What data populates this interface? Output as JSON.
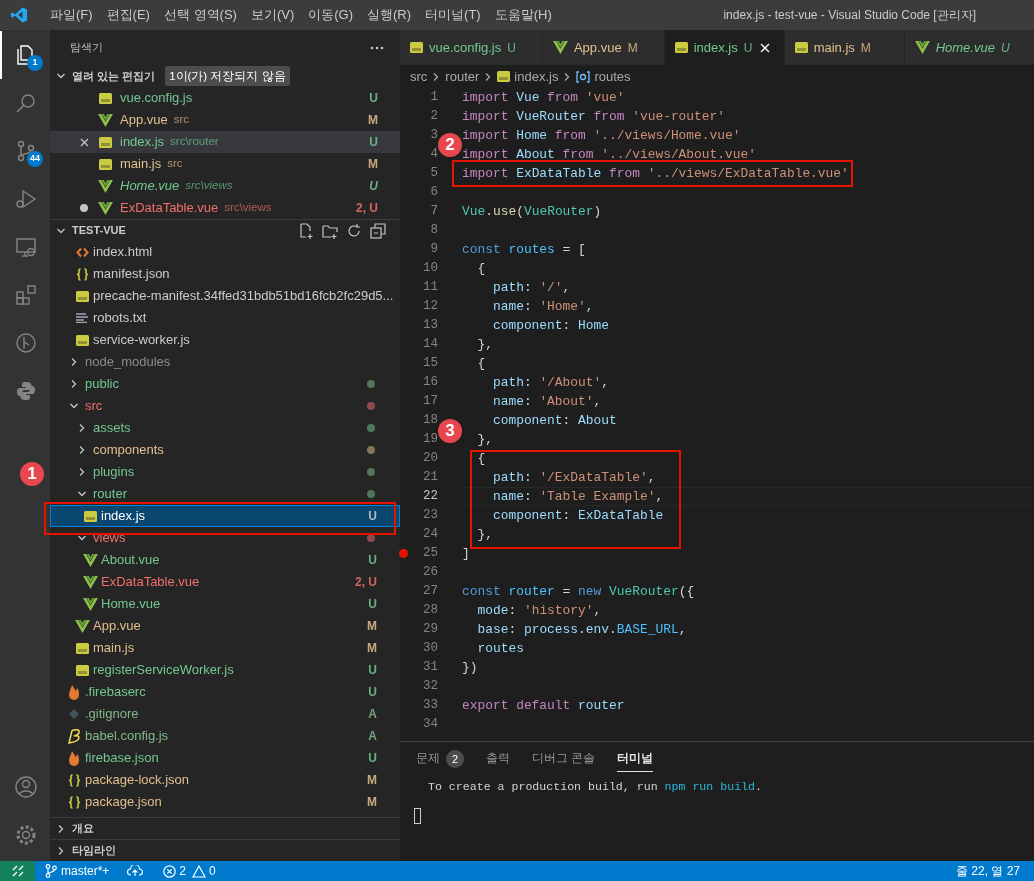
{
  "title_bar": {
    "menu": [
      "파일(F)",
      "편집(E)",
      "선택 영역(S)",
      "보기(V)",
      "이동(G)",
      "실행(R)",
      "터미널(T)",
      "도움말(H)"
    ],
    "title": "index.js - test-vue - Visual Studio Code [관리자]"
  },
  "activity_bar": [
    {
      "kind": "explorer",
      "selected": true,
      "badge": "1"
    },
    {
      "kind": "search",
      "selected": false
    },
    {
      "kind": "scm",
      "selected": false,
      "badge": "44"
    },
    {
      "kind": "debug",
      "selected": false
    },
    {
      "kind": "remote",
      "selected": false
    },
    {
      "kind": "extensions",
      "selected": false
    },
    {
      "kind": "git-graph",
      "selected": false
    },
    {
      "kind": "python",
      "selected": false
    }
  ],
  "activity_bottom": [
    {
      "kind": "account"
    },
    {
      "kind": "settings"
    }
  ],
  "sidebar": {
    "title": "탐색기",
    "open_editors": {
      "title": "열려 있는 편집기",
      "expanded": true,
      "badge": "1이(가) 저장되지 않음",
      "items": [
        {
          "kind": "js",
          "name": "vue.config.js",
          "status": "U",
          "color": "#73c991",
          "selected": false,
          "dirty": false,
          "italic": false
        },
        {
          "kind": "vue",
          "name": "App.vue",
          "path": "src",
          "status": "M",
          "color": "#e2c08d",
          "selected": false,
          "dirty": false,
          "italic": false
        },
        {
          "kind": "js",
          "name": "index.js",
          "path": "src\\router",
          "status": "U",
          "color": "#73c991",
          "selected": true,
          "dirty": false,
          "italic": false
        },
        {
          "kind": "js",
          "name": "main.js",
          "path": "src",
          "status": "M",
          "color": "#e2c08d",
          "selected": false,
          "dirty": false,
          "italic": false
        },
        {
          "kind": "vue",
          "name": "Home.vue",
          "path": "src\\views",
          "status": "U",
          "color": "#73c991",
          "selected": false,
          "dirty": false,
          "italic": true
        },
        {
          "kind": "vue",
          "name": "ExDataTable.vue",
          "path": "src\\views",
          "status": "2, U",
          "color": "#f0706a",
          "selected": false,
          "dirty": true,
          "italic": false
        }
      ]
    },
    "explorer": {
      "title": "TEST-VUE",
      "expanded": true,
      "continued_items": [
        {
          "kind": "html",
          "name": "index.html",
          "color": "#cccccc",
          "selected": false
        },
        {
          "kind": "json",
          "name": "manifest.json",
          "color": "#cccccc",
          "selected": false
        },
        {
          "kind": "js",
          "name": "precache-manifest.34ffed31bdb51bd16fcb2fc29d5...",
          "color": "#cccccc",
          "selected": false
        },
        {
          "kind": "txt",
          "name": "robots.txt",
          "color": "#cccccc",
          "selected": false
        },
        {
          "kind": "js",
          "name": "service-worker.js",
          "color": "#cccccc",
          "selected": false
        }
      ],
      "tree": [
        {
          "kind": "folder",
          "name": "node_modules",
          "expanded": false,
          "decorated": false,
          "color": "#8c8c8c",
          "selected": false
        },
        {
          "kind": "folder",
          "name": "public",
          "expanded": false,
          "decorated": true,
          "color": "#73c991",
          "selected": false
        },
        {
          "kind": "folder",
          "name": "src",
          "expanded": true,
          "decorated": true,
          "color": "#f0706a",
          "selected": false,
          "children": [
            {
              "kind": "folder",
              "name": "assets",
              "expanded": false,
              "decorated": true,
              "color": "#73c991",
              "selected": false
            },
            {
              "kind": "folder",
              "name": "components",
              "expanded": false,
              "decorated": true,
              "color": "#e2c08d",
              "selected": false
            },
            {
              "kind": "folder",
              "name": "plugins",
              "expanded": false,
              "decorated": true,
              "color": "#73c991",
              "selected": false
            },
            {
              "kind": "folder",
              "name": "router",
              "expanded": true,
              "decorated": true,
              "color": "#73c991",
              "selected": false,
              "children": [
                {
                  "kind": "js",
                  "name": "index.js",
                  "status": "U",
                  "color": "#ffffff",
                  "selected": true
                }
              ]
            },
            {
              "kind": "folder",
              "name": "views",
              "expanded": true,
              "decorated": true,
              "color": "#f0706a",
              "selected": false,
              "children": [
                {
                  "kind": "vue",
                  "name": "About.vue",
                  "status": "U",
                  "color": "#73c991",
                  "selected": false
                },
                {
                  "kind": "vue",
                  "name": "ExDataTable.vue",
                  "status": "2, U",
                  "color": "#f0706a",
                  "selected": false
                },
                {
                  "kind": "vue",
                  "name": "Home.vue",
                  "status": "U",
                  "color": "#73c991",
                  "selected": false
                }
              ]
            },
            {
              "kind": "vue",
              "name": "App.vue",
              "status": "M",
              "color": "#e2c08d",
              "selected": false
            },
            {
              "kind": "js",
              "name": "main.js",
              "status": "M",
              "color": "#e2c08d",
              "selected": false
            },
            {
              "kind": "js",
              "name": "registerServiceWorker.js",
              "status": "U",
              "color": "#73c991",
              "selected": false
            }
          ]
        },
        {
          "kind": "firebase",
          "name": ".firebaserc",
          "status": "U",
          "color": "#73c991",
          "selected": false
        },
        {
          "kind": "git",
          "name": ".gitignore",
          "status": "A",
          "color": "#81b88b",
          "selected": false
        },
        {
          "kind": "babel",
          "name": "babel.config.js",
          "status": "A",
          "color": "#81b88b",
          "selected": false
        },
        {
          "kind": "firebase",
          "name": "firebase.json",
          "status": "U",
          "color": "#73c991",
          "selected": false
        },
        {
          "kind": "json",
          "name": "package-lock.json",
          "status": "M",
          "color": "#e2c08d",
          "selected": false
        },
        {
          "kind": "json",
          "name": "package.json",
          "status": "M",
          "color": "#e2c08d",
          "selected": false
        }
      ]
    },
    "sections": [
      {
        "title": "개요",
        "expanded": false
      },
      {
        "title": "타임라인",
        "expanded": false
      }
    ]
  },
  "editor": {
    "tabs": [
      {
        "kind": "js",
        "name": "vue.config.js",
        "status": "U",
        "color": "#73c991",
        "selected": false,
        "italic": false
      },
      {
        "kind": "vue",
        "name": "App.vue",
        "status": "M",
        "color": "#e2c08d",
        "selected": false,
        "italic": false
      },
      {
        "kind": "js",
        "name": "index.js",
        "status": "U",
        "color": "#73c991",
        "selected": true,
        "italic": false
      },
      {
        "kind": "js",
        "name": "main.js",
        "status": "M",
        "color": "#e2c08d",
        "selected": false,
        "italic": false
      },
      {
        "kind": "vue",
        "name": "Home.vue",
        "status": "U",
        "color": "#73c991",
        "selected": false,
        "italic": true
      }
    ],
    "breadcrumb": [
      {
        "label": "src"
      },
      {
        "label": "router"
      },
      {
        "kind": "js",
        "label": "index.js"
      },
      {
        "kind": "variable",
        "label": "routes"
      }
    ],
    "lines": [
      {
        "n": "1",
        "current": false,
        "breakpoint": false,
        "tokens": [
          {
            "kind": "kw",
            "text": "import "
          },
          {
            "kind": "var",
            "text": "Vue "
          },
          {
            "kind": "kw",
            "text": "from "
          },
          {
            "kind": "str",
            "text": "'vue'"
          }
        ]
      },
      {
        "n": "2",
        "current": false,
        "breakpoint": false,
        "tokens": [
          {
            "kind": "kw",
            "text": "import "
          },
          {
            "kind": "var",
            "text": "VueRouter "
          },
          {
            "kind": "kw",
            "text": "from "
          },
          {
            "kind": "str",
            "text": "'vue-router'"
          }
        ]
      },
      {
        "n": "3",
        "current": false,
        "breakpoint": false,
        "tokens": [
          {
            "kind": "kw",
            "text": "import "
          },
          {
            "kind": "var",
            "text": "Home "
          },
          {
            "kind": "kw",
            "text": "from "
          },
          {
            "kind": "str",
            "text": "'../views/Home.vue'"
          }
        ]
      },
      {
        "n": "4",
        "current": false,
        "breakpoint": false,
        "tokens": [
          {
            "kind": "kw",
            "text": "import "
          },
          {
            "kind": "var",
            "text": "About "
          },
          {
            "kind": "kw",
            "text": "from "
          },
          {
            "kind": "str",
            "text": "'../views/About.vue'"
          }
        ]
      },
      {
        "n": "5",
        "current": false,
        "breakpoint": false,
        "tokens": [
          {
            "kind": "kw",
            "text": "import "
          },
          {
            "kind": "var",
            "text": "ExDataTable "
          },
          {
            "kind": "kw",
            "text": "from "
          },
          {
            "kind": "str",
            "text": "'../views/ExDataTable.vue'"
          }
        ]
      },
      {
        "n": "6",
        "current": false,
        "breakpoint": false
      },
      {
        "n": "7",
        "current": false,
        "breakpoint": false,
        "tokens": [
          {
            "kind": "cls",
            "text": "Vue"
          },
          {
            "kind": "plain",
            "text": "."
          },
          {
            "kind": "fn",
            "text": "use"
          },
          {
            "kind": "plain",
            "text": "("
          },
          {
            "kind": "cls",
            "text": "VueRouter"
          },
          {
            "kind": "plain",
            "text": ")"
          }
        ]
      },
      {
        "n": "8",
        "current": false,
        "breakpoint": false
      },
      {
        "n": "9",
        "current": false,
        "breakpoint": false,
        "tokens": [
          {
            "kind": "storage",
            "text": "const "
          },
          {
            "kind": "const",
            "text": "routes"
          },
          {
            "kind": "plain",
            "text": " = ["
          }
        ]
      },
      {
        "n": "10",
        "current": false,
        "breakpoint": false,
        "tokens": [
          {
            "kind": "plain",
            "text": "  {"
          }
        ]
      },
      {
        "n": "11",
        "current": false,
        "breakpoint": false,
        "tokens": [
          {
            "kind": "var",
            "text": "    path"
          },
          {
            "kind": "plain",
            "text": ": "
          },
          {
            "kind": "str",
            "text": "'/'"
          },
          {
            "kind": "plain",
            "text": ","
          }
        ]
      },
      {
        "n": "12",
        "current": false,
        "breakpoint": false,
        "tokens": [
          {
            "kind": "var",
            "text": "    name"
          },
          {
            "kind": "plain",
            "text": ": "
          },
          {
            "kind": "str",
            "text": "'Home'"
          },
          {
            "kind": "plain",
            "text": ","
          }
        ]
      },
      {
        "n": "13",
        "current": false,
        "breakpoint": false,
        "tokens": [
          {
            "kind": "var",
            "text": "    component"
          },
          {
            "kind": "plain",
            "text": ": "
          },
          {
            "kind": "var",
            "text": "Home"
          }
        ]
      },
      {
        "n": "14",
        "current": false,
        "breakpoint": false,
        "tokens": [
          {
            "kind": "plain",
            "text": "  },"
          }
        ]
      },
      {
        "n": "15",
        "current": false,
        "breakpoint": false,
        "tokens": [
          {
            "kind": "plain",
            "text": "  {"
          }
        ]
      },
      {
        "n": "16",
        "current": false,
        "breakpoint": false,
        "tokens": [
          {
            "kind": "var",
            "text": "    path"
          },
          {
            "kind": "plain",
            "text": ": "
          },
          {
            "kind": "str",
            "text": "'/About'"
          },
          {
            "kind": "plain",
            "text": ","
          }
        ]
      },
      {
        "n": "17",
        "current": false,
        "breakpoint": false,
        "tokens": [
          {
            "kind": "var",
            "text": "    name"
          },
          {
            "kind": "plain",
            "text": ": "
          },
          {
            "kind": "str",
            "text": "'About'"
          },
          {
            "kind": "plain",
            "text": ","
          }
        ]
      },
      {
        "n": "18",
        "current": false,
        "breakpoint": false,
        "tokens": [
          {
            "kind": "var",
            "text": "    component"
          },
          {
            "kind": "plain",
            "text": ": "
          },
          {
            "kind": "var",
            "text": "About"
          }
        ]
      },
      {
        "n": "19",
        "current": false,
        "breakpoint": false,
        "tokens": [
          {
            "kind": "plain",
            "text": "  },"
          }
        ]
      },
      {
        "n": "20",
        "current": false,
        "breakpoint": false,
        "tokens": [
          {
            "kind": "plain",
            "text": "  {"
          }
        ]
      },
      {
        "n": "21",
        "current": false,
        "breakpoint": false,
        "tokens": [
          {
            "kind": "var",
            "text": "    path"
          },
          {
            "kind": "plain",
            "text": ": "
          },
          {
            "kind": "str",
            "text": "'/ExDataTable'"
          },
          {
            "kind": "plain",
            "text": ","
          }
        ]
      },
      {
        "n": "22",
        "current": true,
        "breakpoint": false,
        "tokens": [
          {
            "kind": "var",
            "text": "    name"
          },
          {
            "kind": "plain",
            "text": ": "
          },
          {
            "kind": "str",
            "text": "'Table Example'"
          },
          {
            "kind": "plain",
            "text": ","
          }
        ]
      },
      {
        "n": "23",
        "current": false,
        "breakpoint": false,
        "tokens": [
          {
            "kind": "var",
            "text": "    component"
          },
          {
            "kind": "plain",
            "text": ": "
          },
          {
            "kind": "var",
            "text": "ExDataTable"
          }
        ]
      },
      {
        "n": "24",
        "current": false,
        "breakpoint": false,
        "tokens": [
          {
            "kind": "plain",
            "text": "  },"
          }
        ]
      },
      {
        "n": "25",
        "current": false,
        "breakpoint": true,
        "tokens": [
          {
            "kind": "plain",
            "text": "]"
          }
        ]
      },
      {
        "n": "26",
        "current": false,
        "breakpoint": false
      },
      {
        "n": "27",
        "current": false,
        "breakpoint": false,
        "tokens": [
          {
            "kind": "storage",
            "text": "const "
          },
          {
            "kind": "const",
            "text": "router"
          },
          {
            "kind": "plain",
            "text": " = "
          },
          {
            "kind": "storage",
            "text": "new "
          },
          {
            "kind": "cls",
            "text": "VueRouter"
          },
          {
            "kind": "plain",
            "text": "({"
          }
        ]
      },
      {
        "n": "28",
        "current": false,
        "breakpoint": false,
        "tokens": [
          {
            "kind": "var",
            "text": "  mode"
          },
          {
            "kind": "plain",
            "text": ": "
          },
          {
            "kind": "str",
            "text": "'history'"
          },
          {
            "kind": "plain",
            "text": ","
          }
        ]
      },
      {
        "n": "29",
        "current": false,
        "breakpoint": false,
        "tokens": [
          {
            "kind": "var",
            "text": "  base"
          },
          {
            "kind": "plain",
            "text": ": "
          },
          {
            "kind": "var",
            "text": "process"
          },
          {
            "kind": "plain",
            "text": "."
          },
          {
            "kind": "var",
            "text": "env"
          },
          {
            "kind": "plain",
            "text": "."
          },
          {
            "kind": "const",
            "text": "BASE_URL"
          },
          {
            "kind": "plain",
            "text": ","
          }
        ]
      },
      {
        "n": "30",
        "current": false,
        "breakpoint": false,
        "tokens": [
          {
            "kind": "var",
            "text": "  routes"
          }
        ]
      },
      {
        "n": "31",
        "current": false,
        "breakpoint": false,
        "tokens": [
          {
            "kind": "plain",
            "text": "})"
          }
        ]
      },
      {
        "n": "32",
        "current": false,
        "breakpoint": false
      },
      {
        "n": "33",
        "current": false,
        "breakpoint": false,
        "tokens": [
          {
            "kind": "kw",
            "text": "export default "
          },
          {
            "kind": "var",
            "text": "router"
          }
        ]
      },
      {
        "n": "34",
        "current": false,
        "breakpoint": false
      }
    ]
  },
  "panel": {
    "tabs": [
      {
        "label": "문제",
        "badge": "2",
        "selected": false
      },
      {
        "label": "출력",
        "selected": false
      },
      {
        "label": "디버그 콘솔",
        "selected": false
      },
      {
        "label": "터미널",
        "selected": true
      }
    ],
    "terminal_lines": [
      [
        {
          "kind": "plain",
          "text": "To create a production build, run "
        },
        {
          "kind": "cmd",
          "text": "npm run build"
        },
        {
          "kind": "plain",
          "text": "."
        }
      ]
    ],
    "cursor": true
  },
  "status_bar": {
    "branch": "master*+",
    "errors": "2",
    "warnings": "0",
    "position": "줄 22, 열 27"
  },
  "annotations": [
    {
      "label": "1"
    },
    {
      "label": "2"
    },
    {
      "label": "3"
    }
  ]
}
